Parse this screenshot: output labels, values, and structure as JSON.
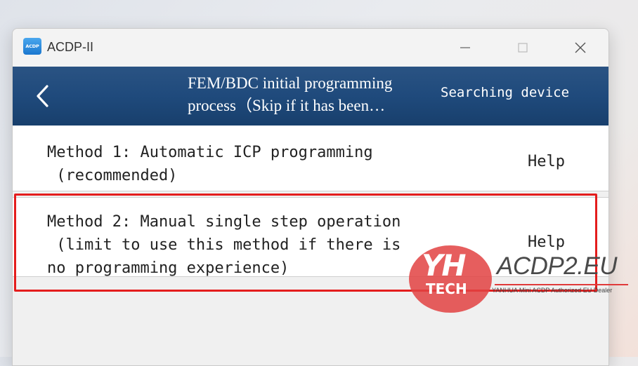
{
  "window": {
    "title": "ACDP-II",
    "icon_label": "ACDP",
    "controls": {
      "minimize_icon": "minimize-icon",
      "maximize_icon": "maximize-icon",
      "close_icon": "close-icon"
    }
  },
  "header": {
    "back_icon": "chevron-left-icon",
    "title_line1": "FEM/BDC initial programming",
    "title_line2": "process（Skip if it has been…",
    "status": "Searching device",
    "background_color": "#1f4a7c"
  },
  "methods": [
    {
      "line1": "Method 1: Automatic ICP programming",
      "line2": " (recommended)",
      "help_label": "Help"
    },
    {
      "line1": "Method 2: Manual single step operation",
      "line2": " (limit to use this method if there is",
      "line3": "no programming experience)",
      "help_label": "Help",
      "highlighted": true
    }
  ],
  "highlight_color": "#e41d1d",
  "watermark": {
    "logo_letters": "YH",
    "logo_word": "TECH",
    "brand": "ACDP2.EU",
    "tagline": "YANHUA Mini ACDP Authorized EU Dealer"
  }
}
